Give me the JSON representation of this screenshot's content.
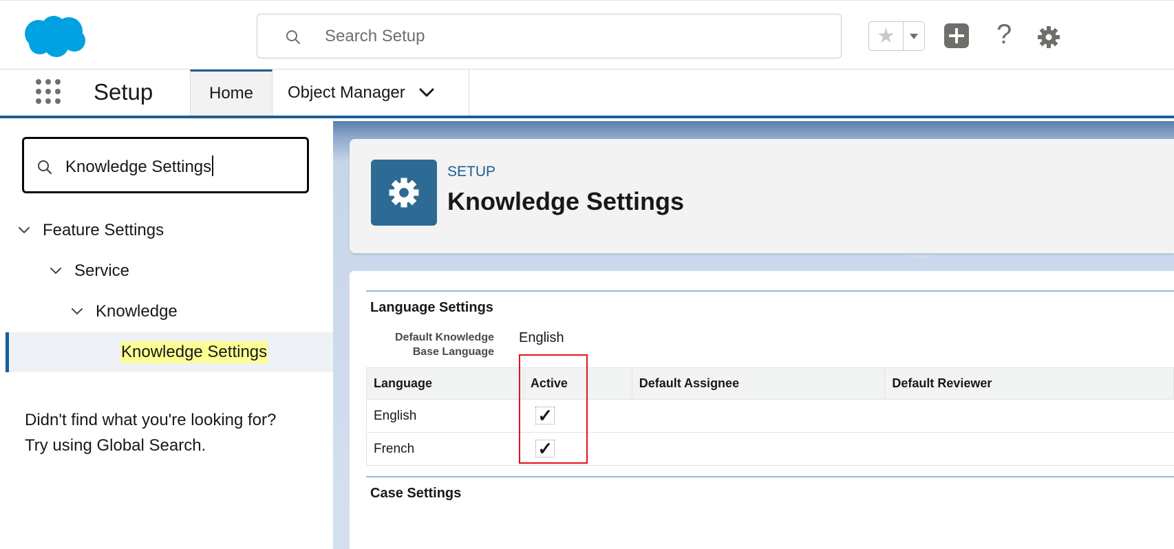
{
  "header": {
    "search_placeholder": "Search Setup",
    "help_glyph": "?",
    "icons": [
      "salesforce-cloud-logo",
      "search-icon",
      "star-icon",
      "dropdown-icon",
      "plus-icon",
      "help-icon",
      "gear-icon"
    ],
    "brand_color": "#00a1e0"
  },
  "nav": {
    "app_name": "Setup",
    "tabs": [
      {
        "label": "Home",
        "active": true
      },
      {
        "label": "Object Manager",
        "has_menu": true
      }
    ],
    "accent_color": "#1b5f96"
  },
  "sidebar": {
    "quick_find_value": "Knowledge Settings",
    "tree": [
      {
        "label": "Feature Settings",
        "level": 0,
        "expanded": true
      },
      {
        "label": "Service",
        "level": 1,
        "expanded": true
      },
      {
        "label": "Knowledge",
        "level": 2,
        "expanded": true
      },
      {
        "label": "Knowledge Settings",
        "level": 3,
        "selected": true
      }
    ],
    "not_found_line1": "Didn't find what you're looking for?",
    "not_found_line2": "Try using Global Search."
  },
  "page_header": {
    "kicker": "SETUP",
    "title": "Knowledge Settings"
  },
  "language_settings": {
    "section_title": "Language Settings",
    "default_label_line1": "Default Knowledge",
    "default_label_line2": "Base Language",
    "default_value": "English",
    "columns": [
      "Language",
      "Active",
      "Default Assignee",
      "Default Reviewer"
    ],
    "rows": [
      {
        "language": "English",
        "active": "✓",
        "assignee": "",
        "reviewer": ""
      },
      {
        "language": "French",
        "active": "✓",
        "assignee": "",
        "reviewer": ""
      }
    ]
  },
  "case_settings": {
    "section_title": "Case Settings"
  },
  "annotation": {
    "highlight_color": "#e2101b"
  }
}
